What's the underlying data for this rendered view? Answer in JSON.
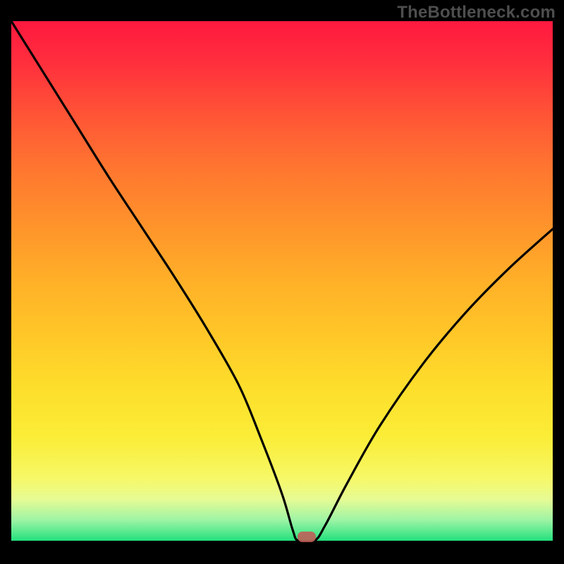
{
  "watermark": "TheBottleneck.com",
  "chart_data": {
    "type": "line",
    "title": "",
    "xlabel": "",
    "ylabel": "",
    "xlim": [
      0,
      100
    ],
    "ylim": [
      0,
      100
    ],
    "series": [
      {
        "name": "bottleneck-curve",
        "x": [
          0,
          6,
          12,
          18,
          24,
          30,
          36,
          42,
          46,
          50,
          52,
          53,
          56,
          58,
          62,
          68,
          76,
          84,
          92,
          100
        ],
        "values": [
          100,
          90,
          80,
          70,
          60.5,
          51,
          41,
          30,
          20,
          9,
          2,
          0,
          0,
          3,
          11,
          22,
          34,
          44,
          52.5,
          60
        ]
      }
    ],
    "marker": {
      "x": 54.5,
      "y": 0.5
    }
  },
  "colors": {
    "gradient_top": "#ff183f",
    "gradient_bottom": "#23e17e",
    "curve": "#000000",
    "marker": "#c35b57",
    "frame": "#000000",
    "watermark": "#4e4e4e"
  }
}
